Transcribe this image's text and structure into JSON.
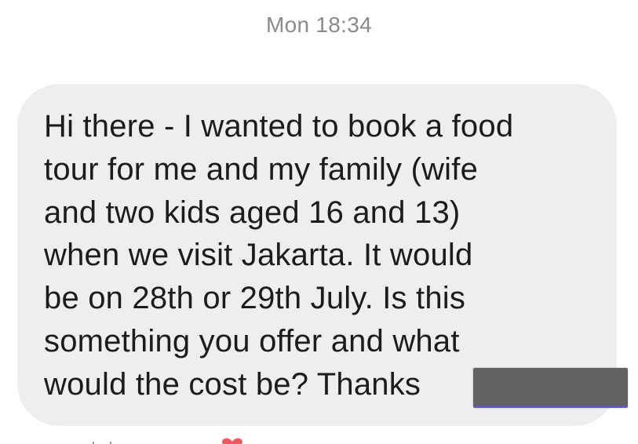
{
  "conversation": {
    "timestamp": "Mon 18:34",
    "message": {
      "lines": [
        "Hi there - I wanted to book a food",
        "tour for me and my family (wife",
        "and two kids aged 16 and 13)",
        "when we visit Jakarta. It would",
        "be on 28th or 29th July. Is this",
        "something you offer and what",
        "would the cost be? Thanks"
      ],
      "bubble_color": "#eeeeee",
      "text_color": "#1c1c1e"
    },
    "redaction_color": "#636366",
    "reaction": {
      "icon": "heart-icon",
      "color": "#e5484d"
    }
  }
}
